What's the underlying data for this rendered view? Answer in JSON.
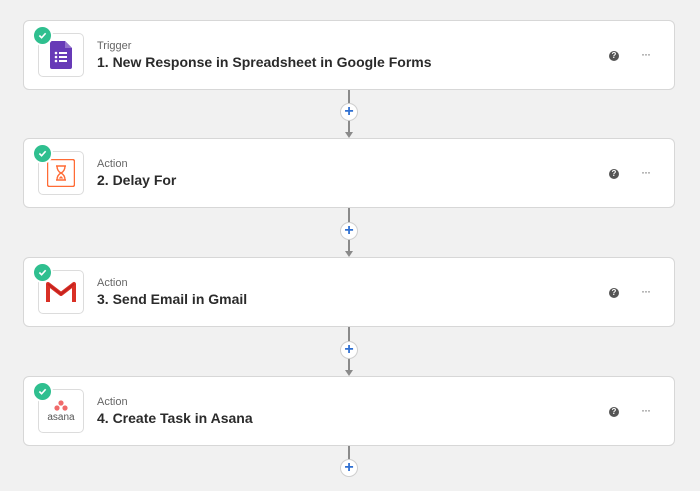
{
  "steps": [
    {
      "type": "Trigger",
      "title": "1. New Response in Spreadsheet in Google Forms",
      "icon": "google-forms-icon"
    },
    {
      "type": "Action",
      "title": "2. Delay For",
      "icon": "delay-hourglass-icon"
    },
    {
      "type": "Action",
      "title": "3. Send Email in Gmail",
      "icon": "gmail-icon"
    },
    {
      "type": "Action",
      "title": "4. Create Task in Asana",
      "icon": "asana-icon",
      "icon_text": "asana"
    }
  ],
  "help_label": "?",
  "more_label": "···",
  "add_label": "+",
  "colors": {
    "check": "#2fbf8f",
    "forms_purple": "#673ab7",
    "delay_orange": "#ff6b35",
    "gmail_red": "#d93025",
    "asana_pink": "#f06a6a",
    "plus_blue": "#2f6fd1"
  }
}
